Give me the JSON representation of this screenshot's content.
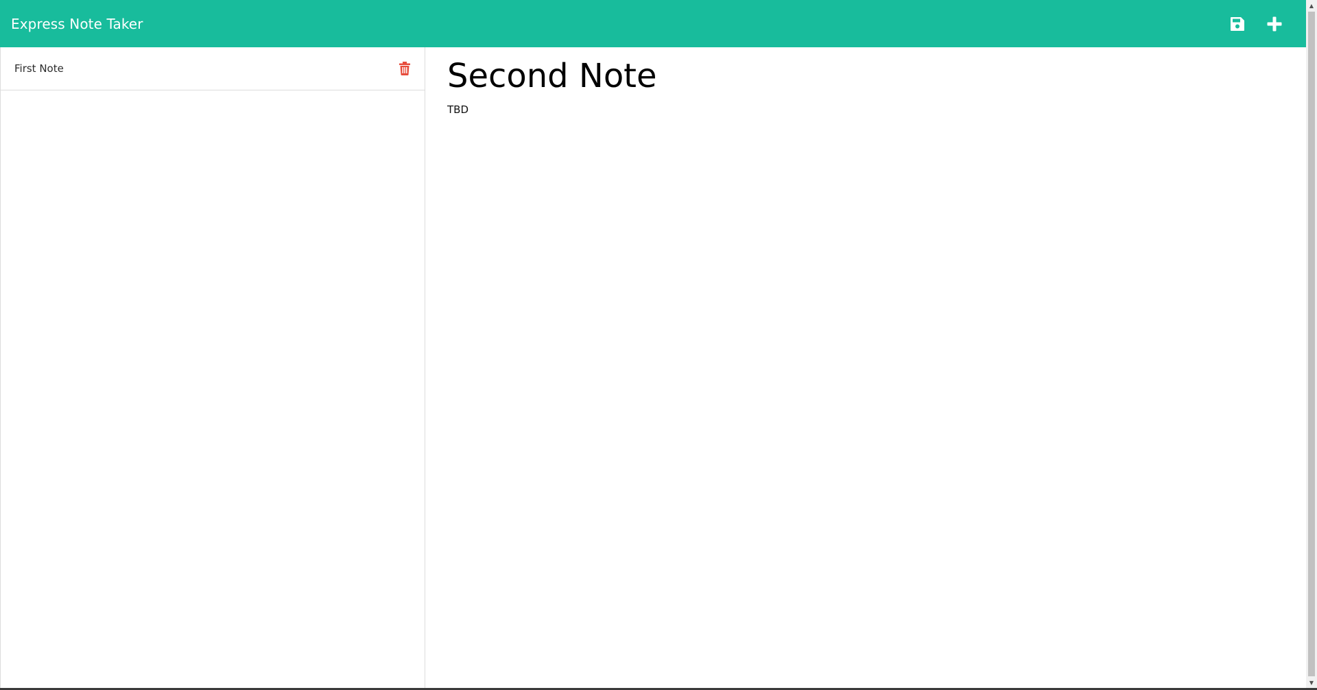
{
  "app": {
    "title": "Express Note Taker"
  },
  "toolbar": {
    "save_icon": "floppy-disk-icon",
    "new_icon": "plus-icon"
  },
  "notes": [
    {
      "title": "First Note",
      "delete_icon": "trash-icon"
    }
  ],
  "active_note": {
    "title": "Second Note",
    "text": "TBD"
  },
  "colors": {
    "navbar": "#18bc9c",
    "delete": "#e74c3c"
  }
}
